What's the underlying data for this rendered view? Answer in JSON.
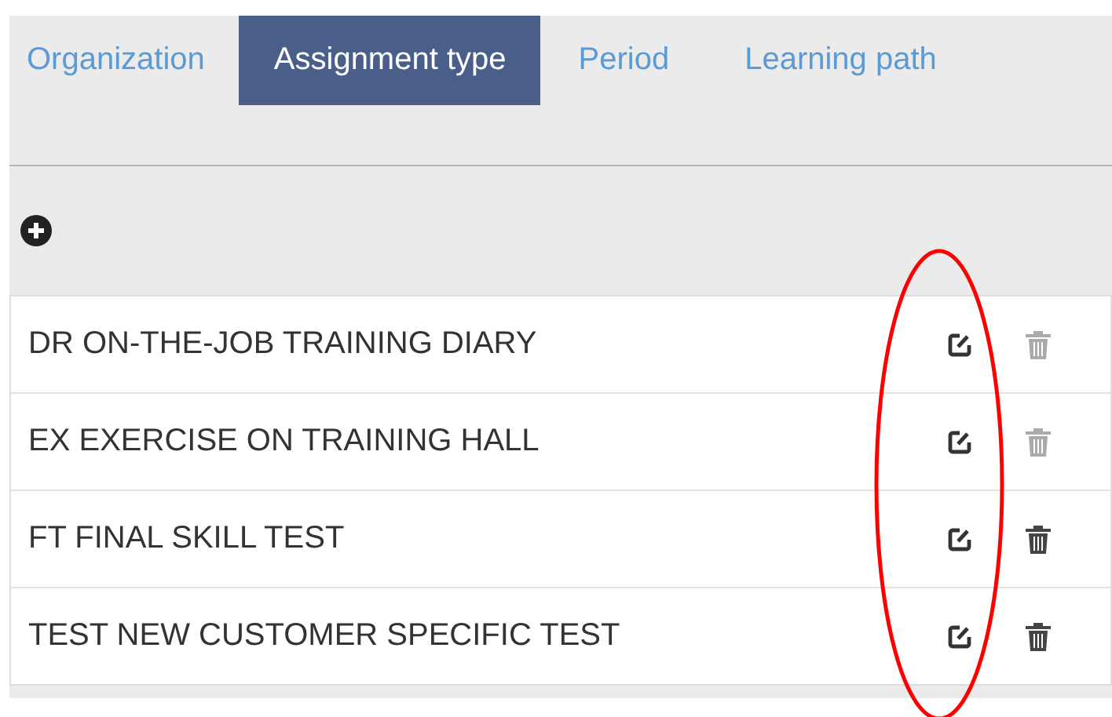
{
  "tabs": [
    {
      "label": "Organization",
      "selected": false
    },
    {
      "label": "Assignment type",
      "selected": true
    },
    {
      "label": "Period",
      "selected": false
    },
    {
      "label": "Learning path",
      "selected": false
    }
  ],
  "rows": [
    {
      "label": "DR ON-THE-JOB TRAINING DIARY",
      "delete_disabled": true
    },
    {
      "label": "EX EXERCISE ON TRAINING HALL",
      "delete_disabled": true
    },
    {
      "label": "FT FINAL SKILL TEST",
      "delete_disabled": false
    },
    {
      "label": "TEST NEW CUSTOMER SPECIFIC TEST",
      "delete_disabled": false
    }
  ],
  "annotation": {
    "kind": "ellipse"
  }
}
